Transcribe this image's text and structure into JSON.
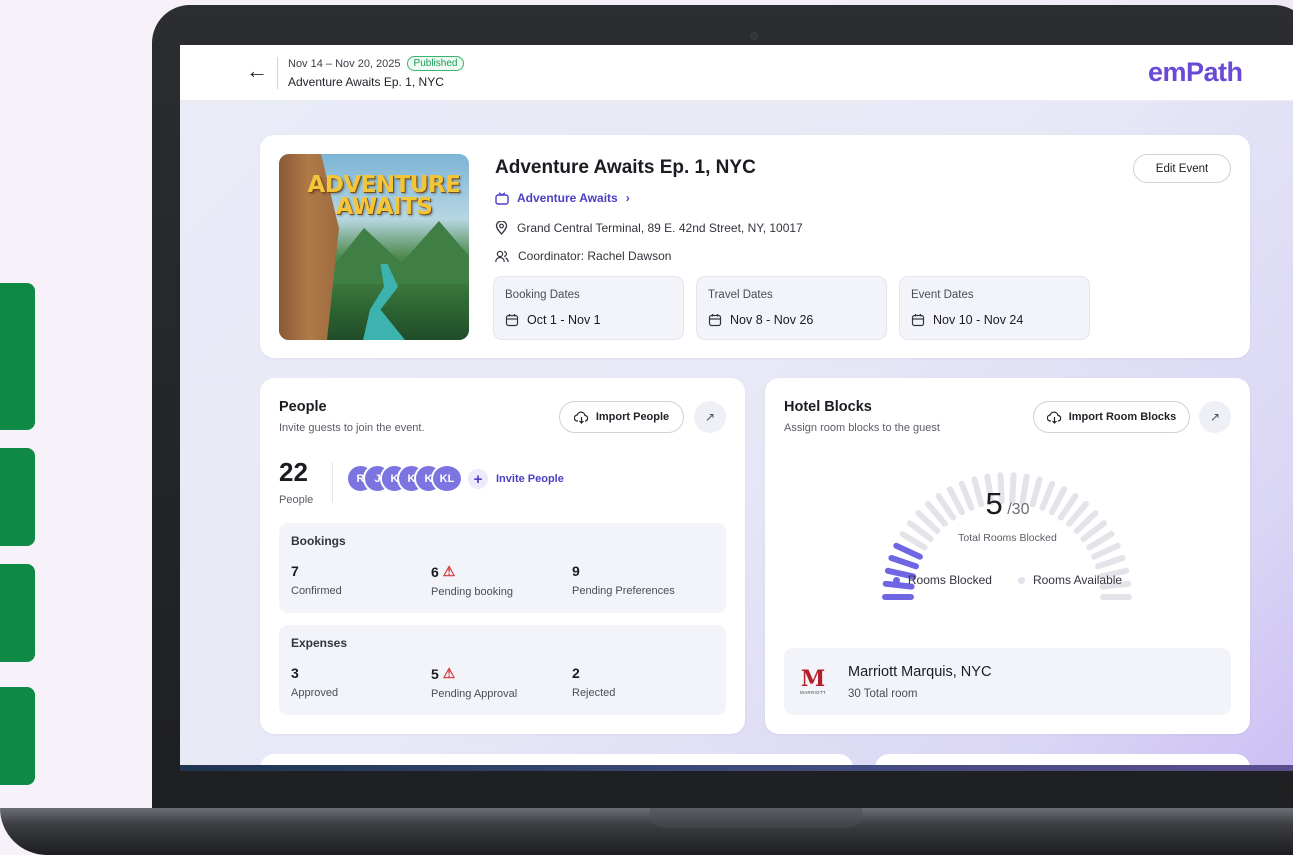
{
  "header": {
    "date_range": "Nov 14 – Nov 20, 2025",
    "status": "Published",
    "event_name": "Adventure Awaits Ep. 1, NYC",
    "logo": "emPath",
    "back_icon": "arrow-left-icon"
  },
  "event": {
    "image_title_line1": "ADVENTURE",
    "image_title_line2": "AWAITS",
    "title": "Adventure Awaits Ep. 1, NYC",
    "series": "Adventure Awaits",
    "address": "Grand Central Terminal, 89 E. 42nd Street, NY, 10017",
    "coordinator": "Coordinator: Rachel Dawson",
    "edit_label": "Edit Event",
    "dates": [
      {
        "label": "Booking Dates",
        "value": "Oct 1 - Nov 1"
      },
      {
        "label": "Travel Dates",
        "value": "Nov 8 - Nov 26"
      },
      {
        "label": "Event Dates",
        "value": "Nov 10 - Nov 24"
      }
    ]
  },
  "people": {
    "title": "People",
    "subtitle": "Invite guests to join the event.",
    "import_label": "Import People",
    "count": "22",
    "count_label": "People",
    "avatars": [
      "R",
      "J",
      "K",
      "K",
      "K",
      "KL"
    ],
    "invite_label": "Invite People",
    "bookings": {
      "heading": "Bookings",
      "stats": [
        {
          "value": "7",
          "label": "Confirmed",
          "warning": false
        },
        {
          "value": "6",
          "label": "Pending booking",
          "warning": true
        },
        {
          "value": "9",
          "label": "Pending Preferences",
          "warning": false
        }
      ]
    },
    "expenses": {
      "heading": "Expenses",
      "stats": [
        {
          "value": "3",
          "label": "Approved",
          "warning": false
        },
        {
          "value": "5",
          "label": "Pending Approval",
          "warning": true
        },
        {
          "value": "2",
          "label": "Rejected",
          "warning": false
        }
      ]
    }
  },
  "hotel": {
    "title": "Hotel Blocks",
    "subtitle": "Assign room blocks to the guest",
    "import_label": "Import Room Blocks",
    "blocked": 5,
    "blocked_text": "5",
    "total_text": "/30",
    "total": 30,
    "gauge_label": "Total Rooms Blocked",
    "legend_blocked": "Rooms Blocked",
    "legend_available": "Rooms Available",
    "colors": {
      "blocked": "#6f66e3",
      "available": "#e2e4ea"
    },
    "hotel_name": "Marriott Marquis, NYC",
    "hotel_rooms": "30 Total room",
    "hotel_logo_letter": "M",
    "hotel_logo_text": "MARRIOTT"
  }
}
